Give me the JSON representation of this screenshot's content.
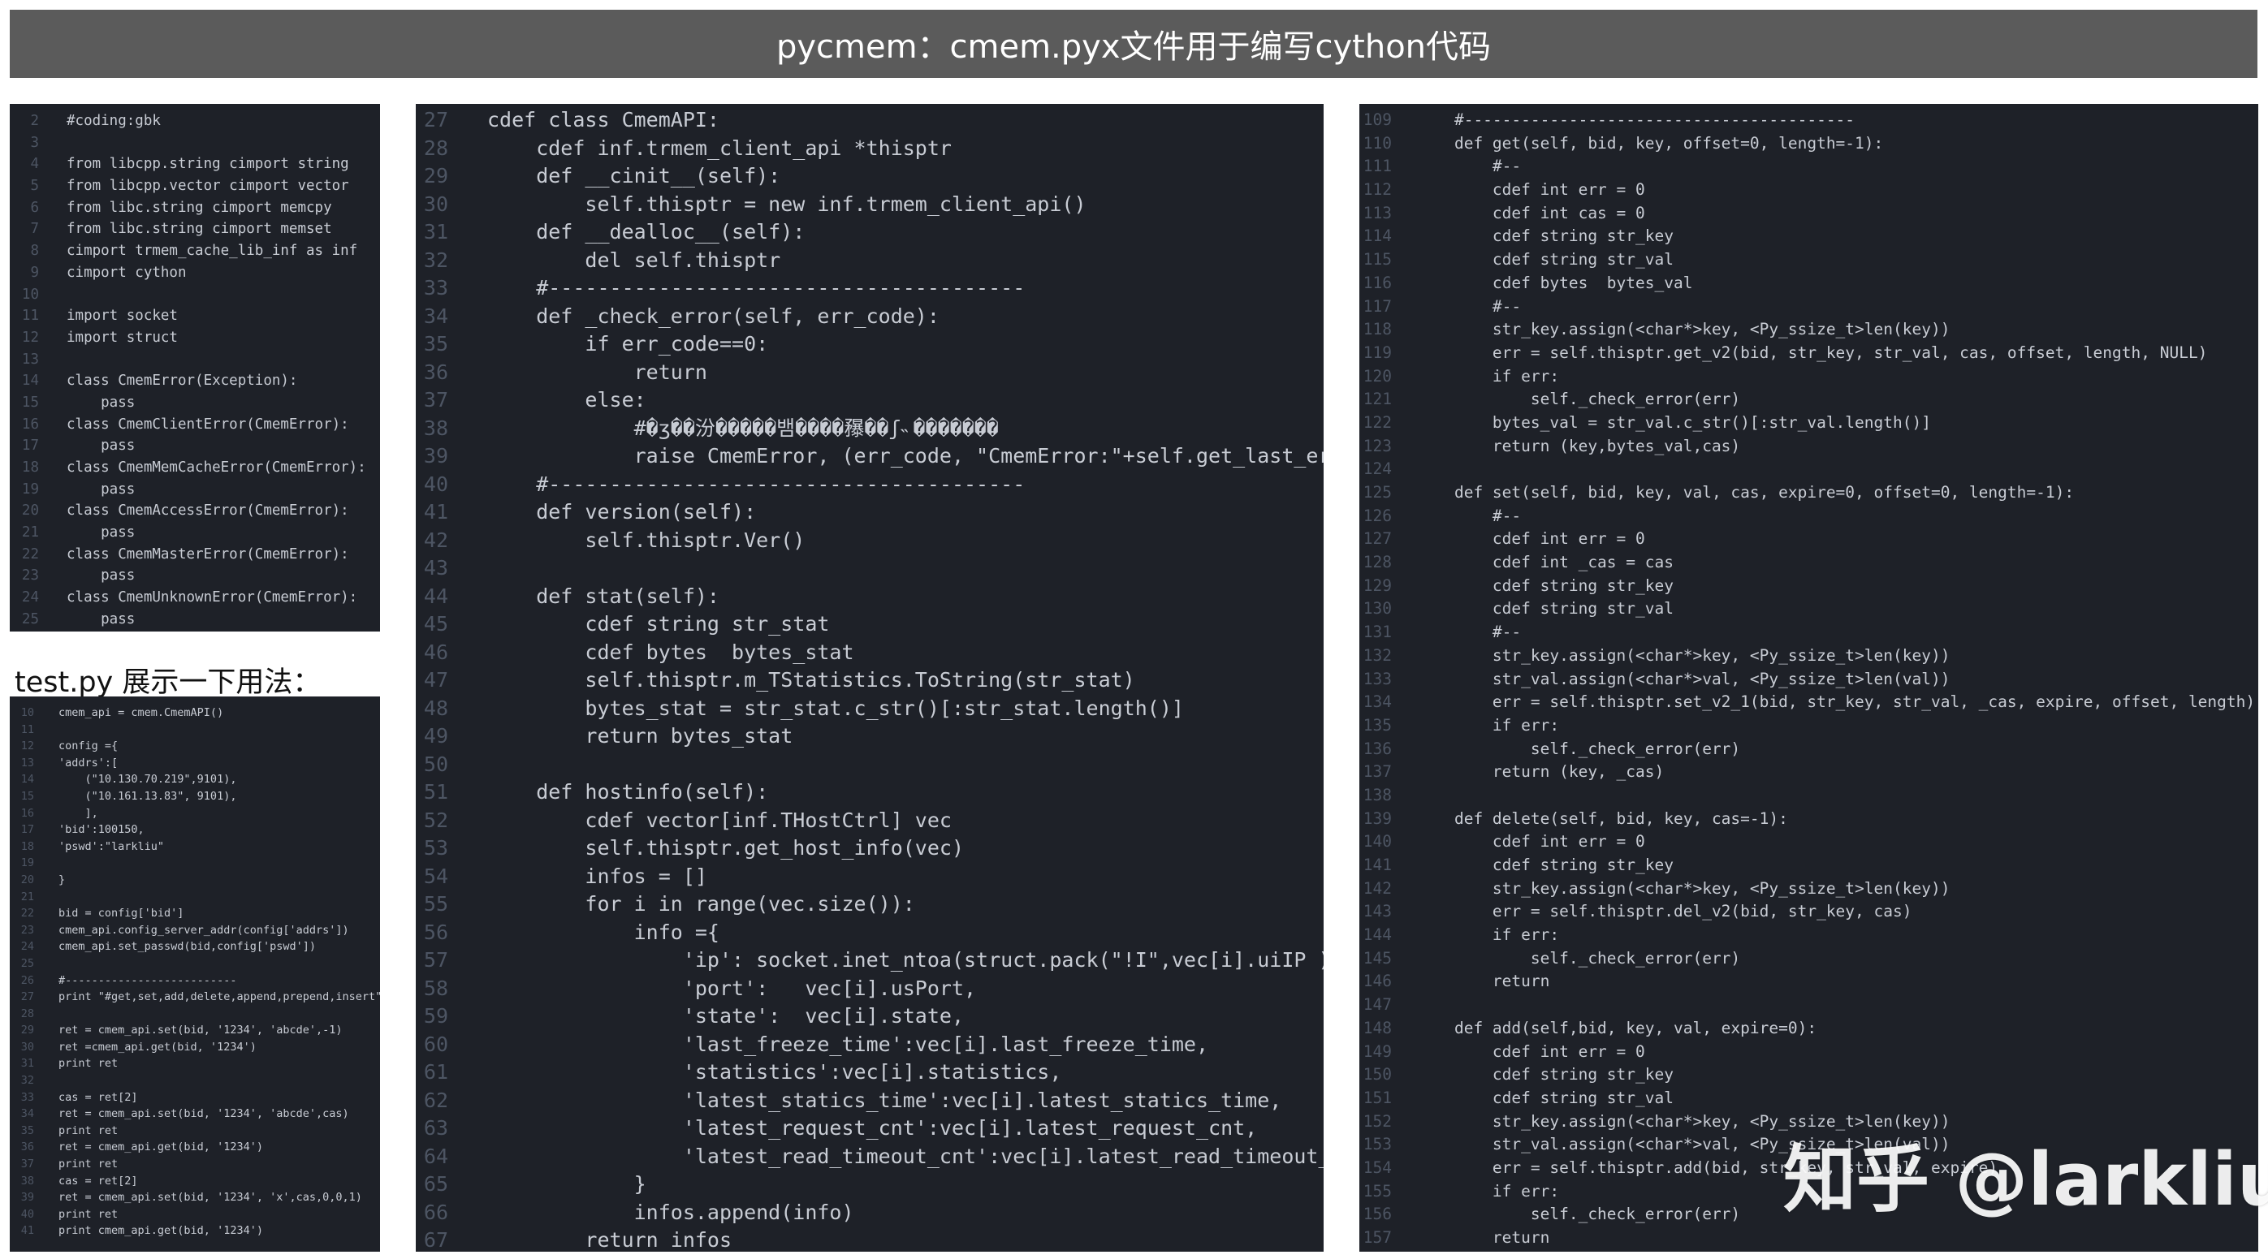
{
  "title": "pycmem：cmem.pyx文件用于编写cython代码",
  "test_label": "test.py 展示一下用法：",
  "watermark": "知乎 @larkliu",
  "colors": {
    "background": "#ffffff",
    "title_bar": "#5b5b5b",
    "panel": "#1e2128",
    "line_number": "#4d5563",
    "code_text": "#c8ccd4"
  },
  "panel_a": {
    "lines": [
      {
        "n": "2",
        "code": "#coding:gbk"
      },
      {
        "n": "3",
        "code": ""
      },
      {
        "n": "4",
        "code": "from libcpp.string cimport string"
      },
      {
        "n": "5",
        "code": "from libcpp.vector cimport vector"
      },
      {
        "n": "6",
        "code": "from libc.string cimport memcpy"
      },
      {
        "n": "7",
        "code": "from libc.string cimport memset"
      },
      {
        "n": "8",
        "code": "cimport trmem_cache_lib_inf as inf"
      },
      {
        "n": "9",
        "code": "cimport cython"
      },
      {
        "n": "10",
        "code": ""
      },
      {
        "n": "11",
        "code": "import socket"
      },
      {
        "n": "12",
        "code": "import struct"
      },
      {
        "n": "13",
        "code": ""
      },
      {
        "n": "14",
        "code": "class CmemError(Exception):"
      },
      {
        "n": "15",
        "code": "    pass"
      },
      {
        "n": "16",
        "code": "class CmemClientError(CmemError):"
      },
      {
        "n": "17",
        "code": "    pass"
      },
      {
        "n": "18",
        "code": "class CmemMemCacheError(CmemError):"
      },
      {
        "n": "19",
        "code": "    pass"
      },
      {
        "n": "20",
        "code": "class CmemAccessError(CmemError):"
      },
      {
        "n": "21",
        "code": "    pass"
      },
      {
        "n": "22",
        "code": "class CmemMasterError(CmemError):"
      },
      {
        "n": "23",
        "code": "    pass"
      },
      {
        "n": "24",
        "code": "class CmemUnknownError(CmemError):"
      },
      {
        "n": "25",
        "code": "    pass"
      }
    ]
  },
  "panel_b": {
    "lines": [
      {
        "n": "10",
        "code": "cmem_api = cmem.CmemAPI()"
      },
      {
        "n": "11",
        "code": ""
      },
      {
        "n": "12",
        "code": "config ={"
      },
      {
        "n": "13",
        "code": "'addrs':["
      },
      {
        "n": "14",
        "code": "    (\"10.130.70.219\",9101),"
      },
      {
        "n": "15",
        "code": "    (\"10.161.13.83\", 9101),"
      },
      {
        "n": "16",
        "code": "    ],"
      },
      {
        "n": "17",
        "code": "'bid':100150,"
      },
      {
        "n": "18",
        "code": "'pswd':\"larkliu\""
      },
      {
        "n": "19",
        "code": ""
      },
      {
        "n": "20",
        "code": "}"
      },
      {
        "n": "21",
        "code": ""
      },
      {
        "n": "22",
        "code": "bid = config['bid']"
      },
      {
        "n": "23",
        "code": "cmem_api.config_server_addr(config['addrs'])"
      },
      {
        "n": "24",
        "code": "cmem_api.set_passwd(bid,config['pswd'])"
      },
      {
        "n": "25",
        "code": ""
      },
      {
        "n": "26",
        "code": "#--------------------------"
      },
      {
        "n": "27",
        "code": "print \"#get,set,add,delete,append,prepend,insert\""
      },
      {
        "n": "28",
        "code": ""
      },
      {
        "n": "29",
        "code": "ret = cmem_api.set(bid, '1234', 'abcde',-1)"
      },
      {
        "n": "30",
        "code": "ret =cmem_api.get(bid, '1234')"
      },
      {
        "n": "31",
        "code": "print ret"
      },
      {
        "n": "32",
        "code": ""
      },
      {
        "n": "33",
        "code": "cas = ret[2]"
      },
      {
        "n": "34",
        "code": "ret = cmem_api.set(bid, '1234', 'abcde',cas)"
      },
      {
        "n": "35",
        "code": "print ret"
      },
      {
        "n": "36",
        "code": "ret = cmem_api.get(bid, '1234')"
      },
      {
        "n": "37",
        "code": "print ret"
      },
      {
        "n": "38",
        "code": "cas = ret[2]"
      },
      {
        "n": "39",
        "code": "ret = cmem_api.set(bid, '1234', 'x',cas,0,0,1)"
      },
      {
        "n": "40",
        "code": "print ret"
      },
      {
        "n": "41",
        "code": "print cmem_api.get(bid, '1234')"
      }
    ]
  },
  "panel_c": {
    "lines": [
      {
        "n": "27",
        "code": "cdef class CmemAPI:"
      },
      {
        "n": "28",
        "code": "    cdef inf.trmem_client_api *thisptr"
      },
      {
        "n": "29",
        "code": "    def __cinit__(self):"
      },
      {
        "n": "30",
        "code": "        self.thisptr = new inf.trmem_client_api()"
      },
      {
        "n": "31",
        "code": "    def __dealloc__(self):"
      },
      {
        "n": "32",
        "code": "        del self.thisptr"
      },
      {
        "n": "33",
        "code": "    #---------------------------------------"
      },
      {
        "n": "34",
        "code": "    def _check_error(self, err_code):"
      },
      {
        "n": "35",
        "code": "        if err_code==0:"
      },
      {
        "n": "36",
        "code": "            return"
      },
      {
        "n": "37",
        "code": "        else:"
      },
      {
        "n": "38",
        "code": "            #�ʒ��汾�����뱀����䂍��ʃ˵�������"
      },
      {
        "n": "39",
        "code": "            raise CmemError, (err_code, \"CmemError:\"+self.get_last_err())"
      },
      {
        "n": "40",
        "code": "    #---------------------------------------"
      },
      {
        "n": "41",
        "code": "    def version(self):"
      },
      {
        "n": "42",
        "code": "        self.thisptr.Ver()"
      },
      {
        "n": "43",
        "code": ""
      },
      {
        "n": "44",
        "code": "    def stat(self):"
      },
      {
        "n": "45",
        "code": "        cdef string str_stat"
      },
      {
        "n": "46",
        "code": "        cdef bytes  bytes_stat"
      },
      {
        "n": "47",
        "code": "        self.thisptr.m_TStatistics.ToString(str_stat)"
      },
      {
        "n": "48",
        "code": "        bytes_stat = str_stat.c_str()[:str_stat.length()]"
      },
      {
        "n": "49",
        "code": "        return bytes_stat"
      },
      {
        "n": "50",
        "code": ""
      },
      {
        "n": "51",
        "code": "    def hostinfo(self):"
      },
      {
        "n": "52",
        "code": "        cdef vector[inf.THostCtrl] vec"
      },
      {
        "n": "53",
        "code": "        self.thisptr.get_host_info(vec)"
      },
      {
        "n": "54",
        "code": "        infos = []"
      },
      {
        "n": "55",
        "code": "        for i in range(vec.size()):"
      },
      {
        "n": "56",
        "code": "            info ={"
      },
      {
        "n": "57",
        "code": "                'ip': socket.inet_ntoa(struct.pack(\"!I\",vec[i].uiIP )),"
      },
      {
        "n": "58",
        "code": "                'port':   vec[i].usPort,"
      },
      {
        "n": "59",
        "code": "                'state':  vec[i].state,"
      },
      {
        "n": "60",
        "code": "                'last_freeze_time':vec[i].last_freeze_time,"
      },
      {
        "n": "61",
        "code": "                'statistics':vec[i].statistics,"
      },
      {
        "n": "62",
        "code": "                'latest_statics_time':vec[i].latest_statics_time,"
      },
      {
        "n": "63",
        "code": "                'latest_request_cnt':vec[i].latest_request_cnt,"
      },
      {
        "n": "64",
        "code": "                'latest_read_timeout_cnt':vec[i].latest_read_timeout_cnt,"
      },
      {
        "n": "65",
        "code": "            }"
      },
      {
        "n": "66",
        "code": "            infos.append(info)"
      },
      {
        "n": "67",
        "code": "        return infos"
      }
    ]
  },
  "panel_d": {
    "lines": [
      {
        "n": "109",
        "code": "    #-----------------------------------------"
      },
      {
        "n": "110",
        "code": "    def get(self, bid, key, offset=0, length=-1):"
      },
      {
        "n": "111",
        "code": "        #--"
      },
      {
        "n": "112",
        "code": "        cdef int err = 0"
      },
      {
        "n": "113",
        "code": "        cdef int cas = 0"
      },
      {
        "n": "114",
        "code": "        cdef string str_key"
      },
      {
        "n": "115",
        "code": "        cdef string str_val"
      },
      {
        "n": "116",
        "code": "        cdef bytes  bytes_val"
      },
      {
        "n": "117",
        "code": "        #--"
      },
      {
        "n": "118",
        "code": "        str_key.assign(<char*>key, <Py_ssize_t>len(key))"
      },
      {
        "n": "119",
        "code": "        err = self.thisptr.get_v2(bid, str_key, str_val, cas, offset, length, NULL)"
      },
      {
        "n": "120",
        "code": "        if err:"
      },
      {
        "n": "121",
        "code": "            self._check_error(err)"
      },
      {
        "n": "122",
        "code": "        bytes_val = str_val.c_str()[:str_val.length()]"
      },
      {
        "n": "123",
        "code": "        return (key,bytes_val,cas)"
      },
      {
        "n": "124",
        "code": ""
      },
      {
        "n": "125",
        "code": "    def set(self, bid, key, val, cas, expire=0, offset=0, length=-1):"
      },
      {
        "n": "126",
        "code": "        #--"
      },
      {
        "n": "127",
        "code": "        cdef int err = 0"
      },
      {
        "n": "128",
        "code": "        cdef int _cas = cas"
      },
      {
        "n": "129",
        "code": "        cdef string str_key"
      },
      {
        "n": "130",
        "code": "        cdef string str_val"
      },
      {
        "n": "131",
        "code": "        #--"
      },
      {
        "n": "132",
        "code": "        str_key.assign(<char*>key, <Py_ssize_t>len(key))"
      },
      {
        "n": "133",
        "code": "        str_val.assign(<char*>val, <Py_ssize_t>len(val))"
      },
      {
        "n": "134",
        "code": "        err = self.thisptr.set_v2_1(bid, str_key, str_val, _cas, expire, offset, length)"
      },
      {
        "n": "135",
        "code": "        if err:"
      },
      {
        "n": "136",
        "code": "            self._check_error(err)"
      },
      {
        "n": "137",
        "code": "        return (key, _cas)"
      },
      {
        "n": "138",
        "code": ""
      },
      {
        "n": "139",
        "code": "    def delete(self, bid, key, cas=-1):"
      },
      {
        "n": "140",
        "code": "        cdef int err = 0"
      },
      {
        "n": "141",
        "code": "        cdef string str_key"
      },
      {
        "n": "142",
        "code": "        str_key.assign(<char*>key, <Py_ssize_t>len(key))"
      },
      {
        "n": "143",
        "code": "        err = self.thisptr.del_v2(bid, str_key, cas)"
      },
      {
        "n": "144",
        "code": "        if err:"
      },
      {
        "n": "145",
        "code": "            self._check_error(err)"
      },
      {
        "n": "146",
        "code": "        return"
      },
      {
        "n": "147",
        "code": ""
      },
      {
        "n": "148",
        "code": "    def add(self,bid, key, val, expire=0):"
      },
      {
        "n": "149",
        "code": "        cdef int err = 0"
      },
      {
        "n": "150",
        "code": "        cdef string str_key"
      },
      {
        "n": "151",
        "code": "        cdef string str_val"
      },
      {
        "n": "152",
        "code": "        str_key.assign(<char*>key, <Py_ssize_t>len(key))"
      },
      {
        "n": "153",
        "code": "        str_val.assign(<char*>val, <Py_ssize_t>len(val))"
      },
      {
        "n": "154",
        "code": "        err = self.thisptr.add(bid, str_key, str_val, expire)"
      },
      {
        "n": "155",
        "code": "        if err:"
      },
      {
        "n": "156",
        "code": "            self._check_error(err)"
      },
      {
        "n": "157",
        "code": "        return"
      }
    ]
  }
}
